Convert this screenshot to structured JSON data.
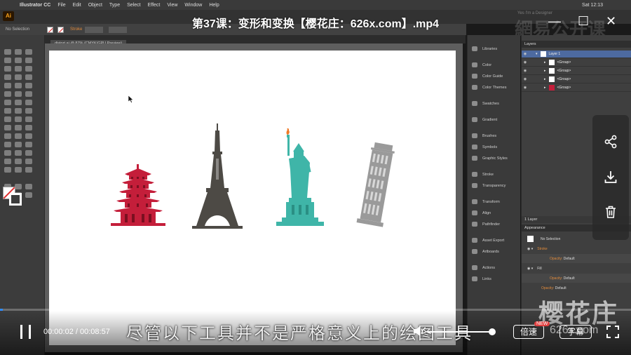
{
  "menubar": {
    "app_name": "Illustrator CC",
    "menus": [
      "File",
      "Edit",
      "Object",
      "Type",
      "Select",
      "Effect",
      "View",
      "Window",
      "Help"
    ],
    "clock": "Sat 12:13"
  },
  "app": {
    "logo": "Ai"
  },
  "controlbar": {
    "selection_label": "No Selection",
    "stroke_label": "Stroke"
  },
  "document": {
    "tab_label": "distort.ai @ 87% (CMYK/GPU Preview)"
  },
  "panels": {
    "middle": [
      "Libraries",
      "Color",
      "Color Guide",
      "Color Themes",
      "Swatches",
      "Gradient",
      "Brushes",
      "Symbols",
      "Graphic Styles",
      "Stroke",
      "Transparency",
      "Transform",
      "Align",
      "Pathfinder",
      "Asset Export",
      "Artboards",
      "Actions",
      "Links"
    ],
    "layers_header": "Layers",
    "layers": [
      {
        "name": "Layer 1",
        "selected": true
      },
      {
        "name": "<Group>",
        "selected": false
      },
      {
        "name": "<Group>",
        "selected": false
      },
      {
        "name": "<Group>",
        "selected": false
      },
      {
        "name": "<Group>",
        "selected": false
      }
    ],
    "layers_footer": "1 Layer",
    "appearance_header": "Appearance",
    "appearance_rows": [
      {
        "label": "No Selection",
        "value": ""
      },
      {
        "label": "Stroke",
        "value": ""
      },
      {
        "label": "Opacity:",
        "value": "Default"
      },
      {
        "label": "Fill",
        "value": ""
      },
      {
        "label": "Opacity:",
        "value": "Default"
      },
      {
        "label": "Opacity:",
        "value": "Default"
      }
    ]
  },
  "video": {
    "title": "第37课：变形和变换【樱花庄：626x.com】.mp4",
    "timecode": "00:00:02 / 00:08:57",
    "subtitle": "尽管以下工具并不是严格意义上的绘图工具",
    "speed_label": "倍速",
    "new_badge": "NEW",
    "captions_label": "字幕",
    "progress": 0.004,
    "volume": 0.9
  },
  "watermarks": {
    "site_cn": "樱花庄",
    "site_url": "626x.com",
    "bg_text": "網易公开课",
    "bg_sub": "Yes I'm a Designer"
  },
  "colors": {
    "pagoda": "#c41e3a",
    "eiffel": "#4d4a45",
    "liberty": "#3fb5a8",
    "pisa": "#9a9a9a",
    "accent": "#2f8cff"
  }
}
